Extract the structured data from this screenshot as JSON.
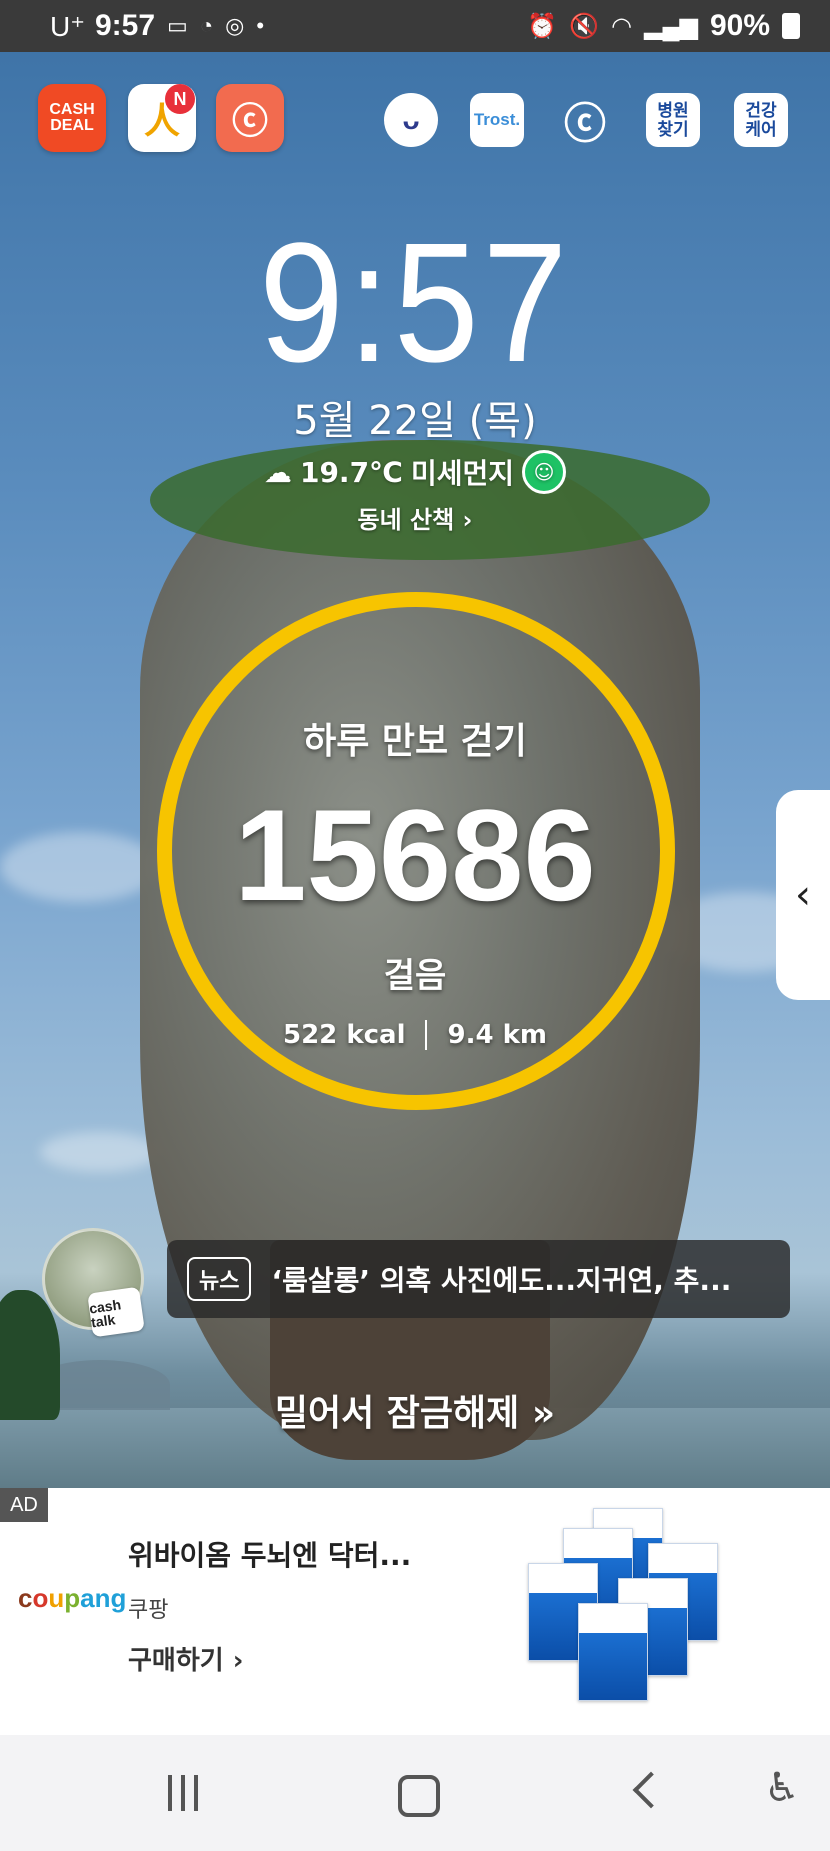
{
  "status_bar": {
    "carrier": "U⁺",
    "time": "9:57",
    "battery": "90%",
    "icons": [
      "cash-icon",
      "timer-icon",
      "instagram-icon",
      "dot-icon",
      "alarm-icon",
      "mute-icon",
      "wifi-icon",
      "signal-icon",
      "battery-icon"
    ]
  },
  "top_apps": {
    "cash_deal": "CASH\nDEAL",
    "app2_badge": "N",
    "trost": "Trost.",
    "hospital": "병원\n찾기",
    "health": "건강\n케어"
  },
  "clock": {
    "time": "9:57",
    "date": "5월 22일 (목)"
  },
  "weather": {
    "temp": "19.7℃",
    "label": "미세먼지",
    "walk_link": "동네 산책 ›"
  },
  "steps": {
    "title": "하루 만보 걷기",
    "count": "15686",
    "unit": "걸음",
    "kcal": "522 kcal",
    "distance": "9.4 km",
    "ring_color": "#f7c400"
  },
  "news": {
    "tag": "뉴스",
    "headline": "‘룸살롱’ 의혹 사진에도...지귀연, 추...",
    "avatar_badge": "cash talk"
  },
  "unlock_text": "밀어서 잠금해제 »",
  "ad": {
    "label": "AD",
    "brand": "coupang",
    "title": "위바이옴 두뇌엔 닥터...",
    "seller": "쿠팡",
    "cta": "구매하기 ›"
  }
}
